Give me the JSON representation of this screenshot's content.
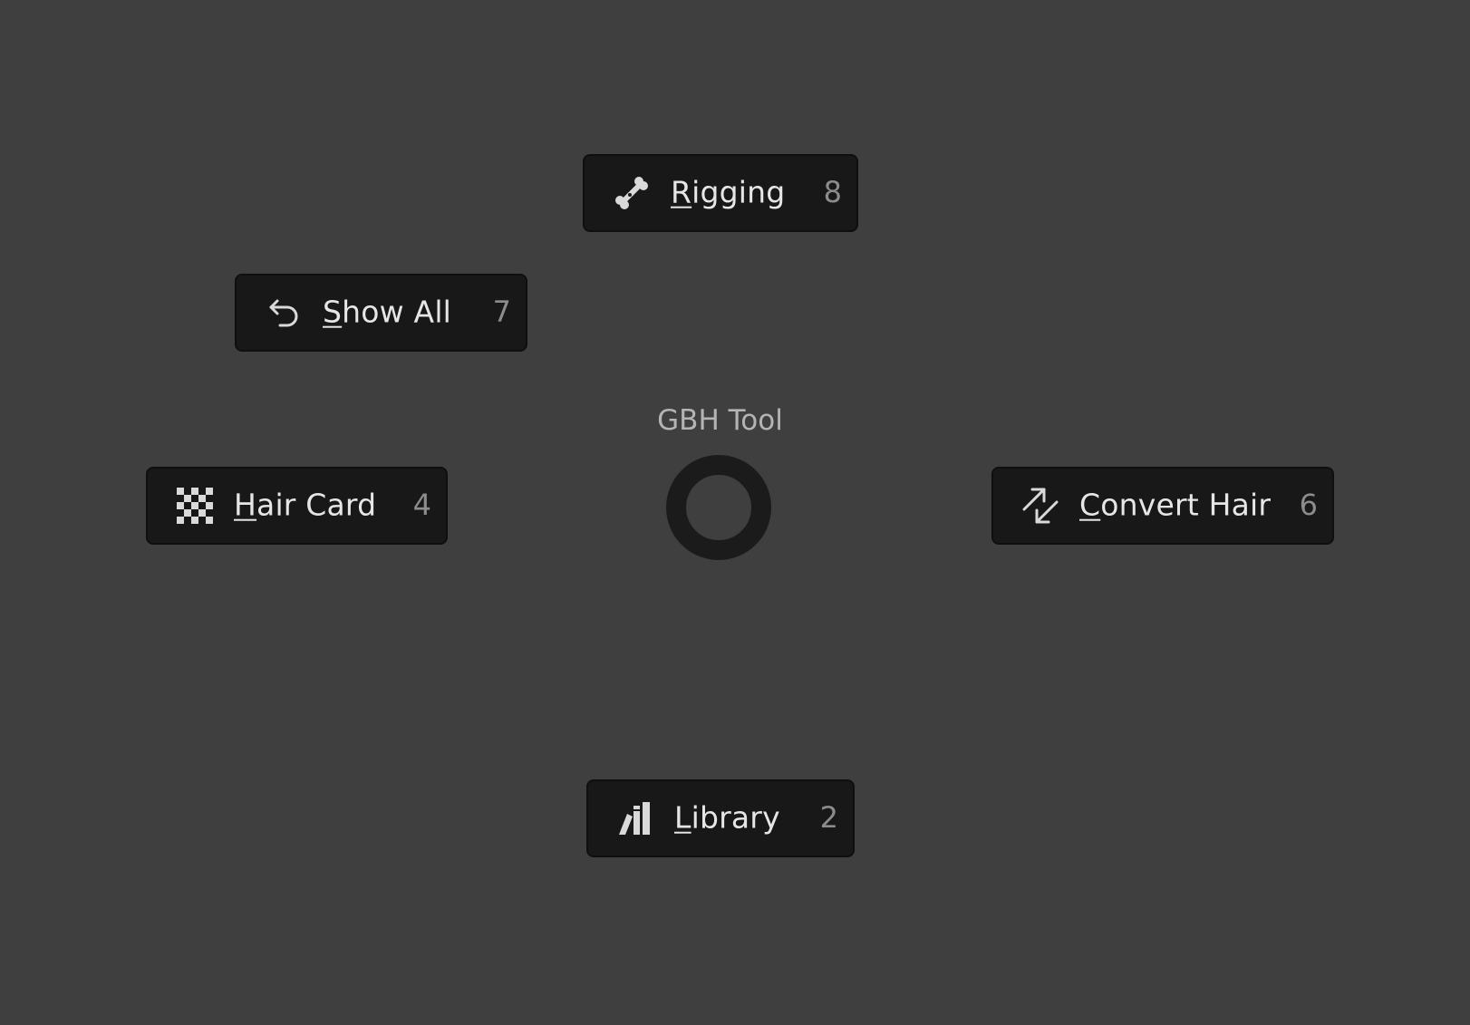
{
  "pie_menu": {
    "title": "GBH Tool",
    "items": {
      "rigging": {
        "mnemonic": "R",
        "rest": "igging",
        "shortcut": "8",
        "icon": "bone-icon"
      },
      "show_all": {
        "mnemonic": "S",
        "rest": "how All",
        "shortcut": "7",
        "icon": "undo-arrow-icon"
      },
      "hair_card": {
        "mnemonic": "H",
        "rest": "air Card",
        "shortcut": "4",
        "icon": "checkerboard-icon"
      },
      "convert_hair": {
        "mnemonic": "C",
        "rest": "onvert Hair",
        "shortcut": "6",
        "icon": "convert-arrows-icon"
      },
      "library": {
        "mnemonic": "L",
        "rest": "ibrary",
        "shortcut": "2",
        "icon": "library-books-icon"
      }
    }
  },
  "colors": {
    "background": "#3f3f3f",
    "item_background": "#181818",
    "text": "#e6e6e6",
    "shortcut_text": "#8c8c8c",
    "title_text": "#b4b4b4"
  }
}
